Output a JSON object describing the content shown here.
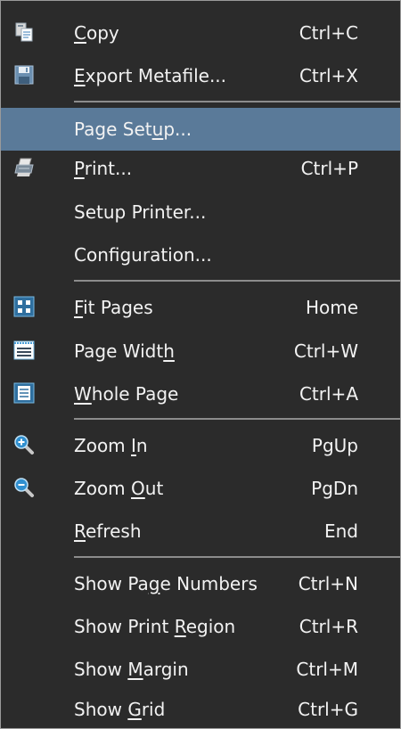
{
  "menu": {
    "items": [
      {
        "label": "Copy",
        "mnemonic": "C",
        "shortcut": "Ctrl+C",
        "icon": "copy-icon"
      },
      {
        "label": "Export Metafile...",
        "mnemonic": "E",
        "shortcut": "Ctrl+X",
        "icon": "save-disk-icon"
      },
      {
        "label": "Page Setup...",
        "mnemonic": "u",
        "shortcut": "",
        "icon": "",
        "highlighted": true
      },
      {
        "label": "Print...",
        "mnemonic": "P",
        "shortcut": "Ctrl+P",
        "icon": "printer-icon"
      },
      {
        "label": "Setup Printer...",
        "shortcut": "",
        "icon": ""
      },
      {
        "label": "Configuration...",
        "shortcut": "",
        "icon": ""
      },
      {
        "label": "Fit Pages",
        "mnemonic": "F",
        "shortcut": "Home",
        "icon": "fit-pages-icon"
      },
      {
        "label": "Page Width",
        "mnemonic": "h",
        "shortcut": "Ctrl+W",
        "icon": "page-width-icon"
      },
      {
        "label": "Whole Page",
        "mnemonic": "W",
        "shortcut": "Ctrl+A",
        "icon": "whole-page-icon"
      },
      {
        "label": "Zoom In",
        "mnemonic": "I",
        "shortcut": "PgUp",
        "icon": "zoom-in-icon"
      },
      {
        "label": "Zoom Out",
        "mnemonic": "O",
        "shortcut": "PgDn",
        "icon": "zoom-out-icon"
      },
      {
        "label": "Refresh",
        "mnemonic": "R",
        "shortcut": "End",
        "icon": ""
      },
      {
        "label": "Show Page Numbers",
        "mnemonic": "g",
        "shortcut": "Ctrl+N",
        "icon": ""
      },
      {
        "label": "Show Print Region",
        "mnemonic": "R",
        "shortcut": "Ctrl+R",
        "icon": ""
      },
      {
        "label": "Show Margin",
        "mnemonic": "M",
        "shortcut": "Ctrl+M",
        "icon": ""
      },
      {
        "label": "Show Grid",
        "mnemonic": "G",
        "shortcut": "Ctrl+G",
        "icon": ""
      }
    ]
  },
  "colors": {
    "menu_background": "#2b2b2b",
    "highlight": "#5a7a99",
    "text": "#f2f2f2",
    "separator": "#8c8c8c",
    "icon_accent": "#4a9fd8"
  }
}
